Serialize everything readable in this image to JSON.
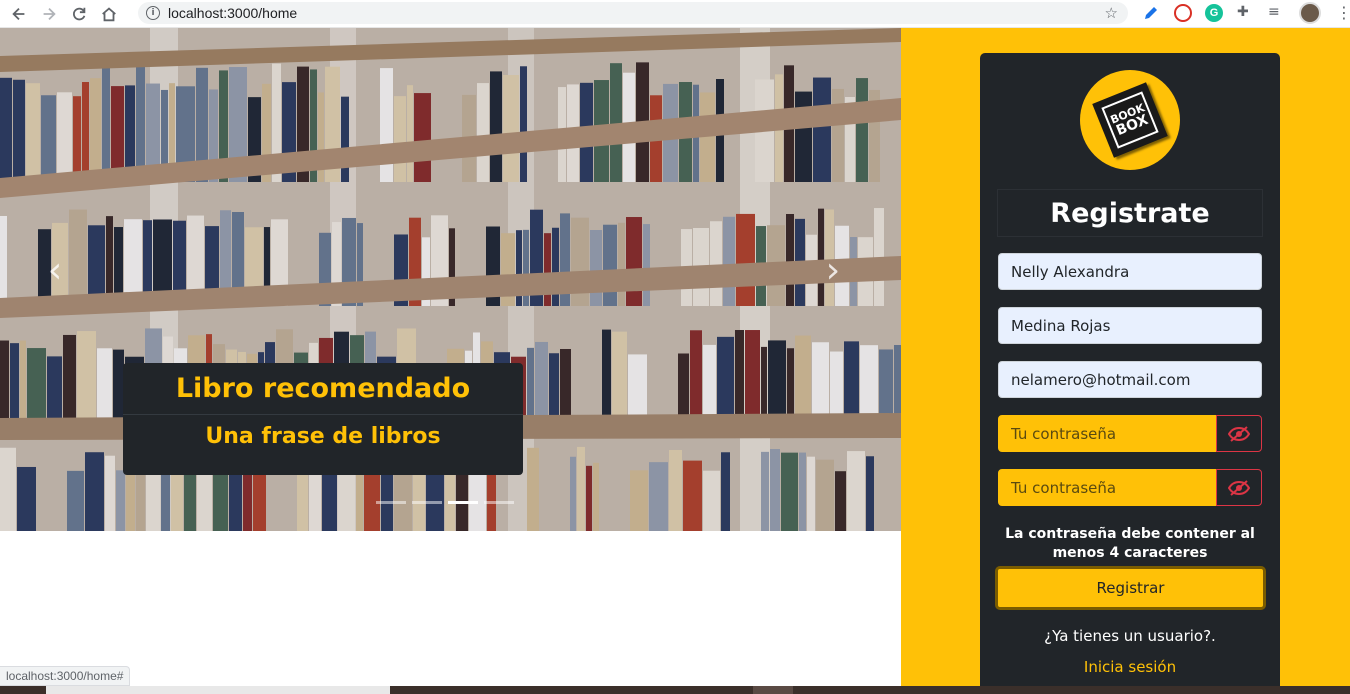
{
  "browser": {
    "url": "localhost:3000/home",
    "status_url": "localhost:3000/home#"
  },
  "carousel": {
    "caption_title": "Libro recomendado",
    "caption_text": "Una frase de libros",
    "prev_symbol": "‹",
    "next_symbol": "›",
    "slides": 4,
    "active_slide": 3
  },
  "logo": {
    "line1": "BOOK",
    "line2": "BOX"
  },
  "register": {
    "title": "Registrate",
    "first_name": "Nelly Alexandra",
    "last_name": "Medina Rojas",
    "email": "nelamero@hotmail.com",
    "password_placeholder": "Tu contraseña",
    "confirm_placeholder": "Tu contraseña",
    "hint": "La contraseña debe contener al menos 4 caracteres",
    "submit_label": "Registrar",
    "have_user": "¿Ya tienes un usuario?.",
    "login_link": "Inicia sesión"
  },
  "colors": {
    "accent": "#ffc107",
    "card": "#212529",
    "danger": "#dc3545"
  }
}
